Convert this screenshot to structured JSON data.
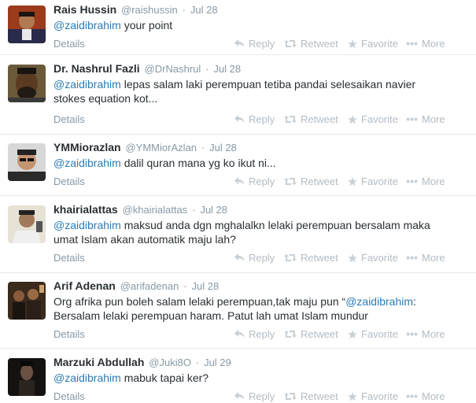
{
  "tweets": [
    {
      "name": "Rais Hussin",
      "handle": "@raishussin",
      "time": "Jul 28",
      "mention": "@zaidibrahim",
      "text": " your point",
      "text2": "",
      "details": "Details",
      "reply": "Reply",
      "retweet": "Retweet",
      "favorite": "Favorite",
      "more": "More"
    },
    {
      "name": "Dr. Nashrul Fazli",
      "handle": "@DrNashrul",
      "time": "Jul 28",
      "mention": "@zaidibrahim",
      "text": " lepas salam laki perempuan tetiba pandai selesaikan navier",
      "text2": "stokes equation kot...",
      "details": "Details",
      "reply": "Reply",
      "retweet": "Retweet",
      "favorite": "Favorite",
      "more": "More"
    },
    {
      "name": "YMMiorazlan",
      "handle": "@YMMiorAzlan",
      "time": "Jul 28",
      "mention": "@zaidibrahim",
      "text": " dalil quran mana yg ko ikut ni...",
      "text2": "",
      "details": "Details",
      "reply": "Reply",
      "retweet": "Retweet",
      "favorite": "Favorite",
      "more": "More"
    },
    {
      "name": "khairialattas",
      "handle": "@khairialattas",
      "time": "Jul 28",
      "mention": "@zaidibrahim",
      "text": " maksud anda dgn mghalalkn lelaki perempuan bersalam maka",
      "text2": "umat Islam akan automatik maju lah?",
      "details": "Details",
      "reply": "Reply",
      "retweet": "Retweet",
      "favorite": "Favorite",
      "more": "More"
    },
    {
      "name": "Arif Adenan",
      "handle": "@arifadenan",
      "time": "Jul 28",
      "mention": "@zaidibrahim",
      "text_before": "Org afrika pun boleh salam lelaki perempuan,tak maju pun “",
      "text": ":",
      "text2": "Bersalam lelaki perempuan haram. Patut lah umat Islam mundur",
      "details": "Details",
      "reply": "Reply",
      "retweet": "Retweet",
      "favorite": "Favorite",
      "more": "More"
    },
    {
      "name": "Marzuki Abdullah",
      "handle": "@Juki8O",
      "time": "Jul 29",
      "mention": "@zaidibrahim",
      "text": " mabuk tapai ker?",
      "text2": "",
      "details": "Details",
      "reply": "Reply",
      "retweet": "Retweet",
      "favorite": "Favorite",
      "more": "More"
    }
  ],
  "separator": "·",
  "icons": {
    "reply": "reply-icon",
    "retweet": "retweet-icon",
    "favorite": "star-icon",
    "more": "more-dots-icon"
  },
  "colors": {
    "link": "#2a7bb6",
    "muted": "#8899a6",
    "action": "#b3bcc4"
  }
}
